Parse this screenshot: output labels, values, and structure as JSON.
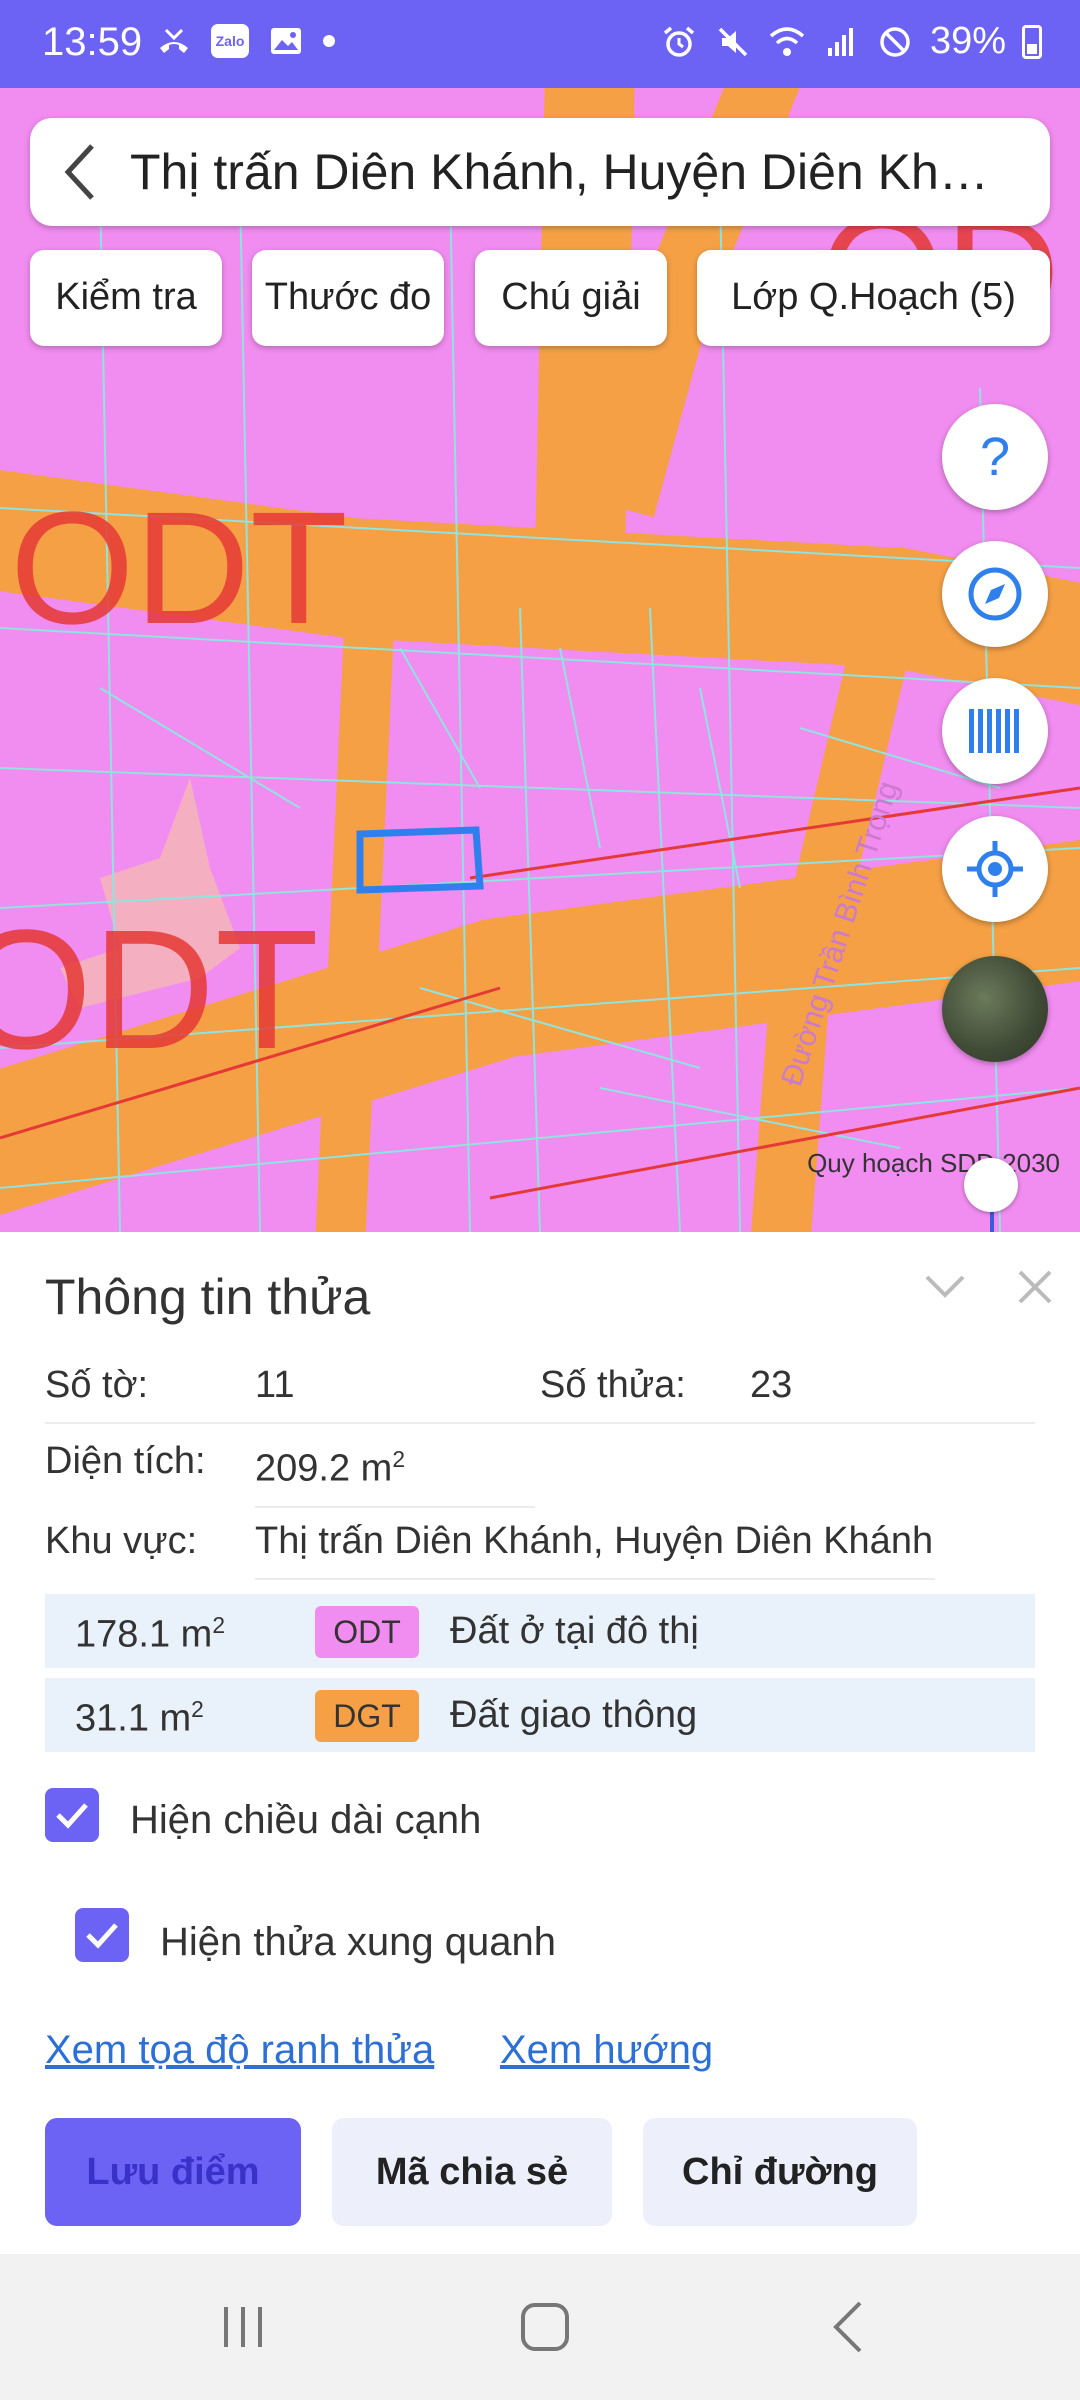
{
  "status_bar": {
    "time": "13:59",
    "left_icons": [
      "missed-call-icon",
      "zalo-icon",
      "gallery-icon",
      "dot-icon"
    ],
    "right_icons": [
      "alarm-icon",
      "mute-icon",
      "wifi-icon",
      "signal-icon",
      "no-disturb-icon"
    ],
    "battery": "39%"
  },
  "search": {
    "text": "Thị trấn Diên Khánh, Huyện Diên Kh…"
  },
  "chips": [
    {
      "label": "Kiểm tra"
    },
    {
      "label": "Thước đo"
    },
    {
      "label": "Chú giải"
    },
    {
      "label": "Lớp Q.Hoạch (5)"
    }
  ],
  "map": {
    "labels": [
      "ODT",
      "ODT",
      "OD"
    ],
    "road_label": "Đường Trần Bình Trọng",
    "layer_label": "Quy hoạch SDĐ 2030",
    "colors": {
      "residential": "#f18cf0",
      "road": "#f5a045",
      "selection": "#2f80ed",
      "parcel_lines": "#8fe4e0",
      "text_red": "#e53935"
    }
  },
  "fabs": [
    "help-icon",
    "compass-icon",
    "barcode-icon",
    "locate-icon",
    "satellite-icon"
  ],
  "sheet": {
    "title": "Thông tin thửa",
    "so_to_label": "Số tờ:",
    "so_to_value": "11",
    "so_thua_label": "Số thửa:",
    "so_thua_value": "23",
    "dien_tich_label": "Diện tích:",
    "dien_tich_value": "209.2 m",
    "khu_vuc_label": "Khu vực:",
    "khu_vuc_value": "Thị trấn Diên Khánh, Huyện Diên Khánh",
    "land_uses": [
      {
        "area": "178.1 m",
        "code": "ODT",
        "desc": "Đất ở tại đô thị",
        "color": "#f18cf0"
      },
      {
        "area": "31.1 m",
        "code": "DGT",
        "desc": "Đất giao thông",
        "color": "#f5a045"
      }
    ],
    "check_edge": "Hiện chiều dài cạnh",
    "check_neighbors": "Hiện thửa xung quanh",
    "link_coords": "Xem tọa độ ranh thửa",
    "link_direction": "Xem hướng",
    "btn_save": "Lưu điểm",
    "btn_share": "Mã chia sẻ",
    "btn_route": "Chỉ đường"
  },
  "superscript": "2"
}
